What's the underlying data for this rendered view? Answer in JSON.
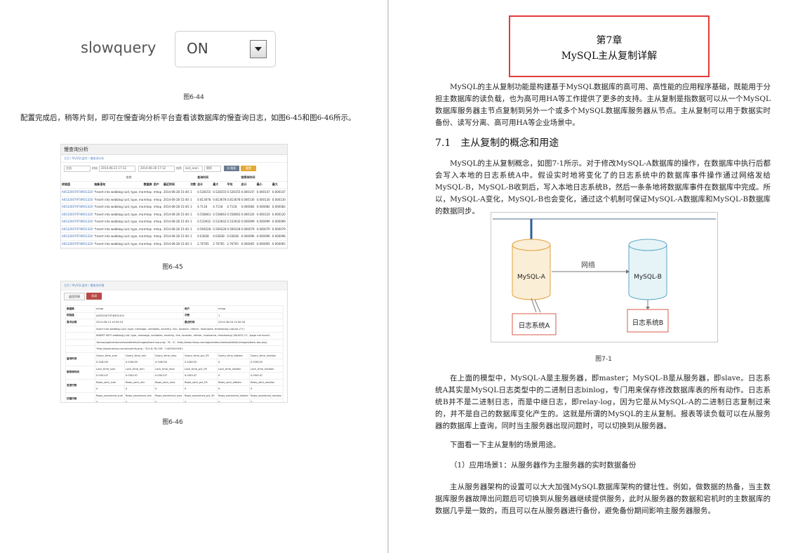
{
  "left": {
    "slowquery": {
      "label": "slowquery",
      "value": "ON"
    },
    "cap_44": "图6-44",
    "para_1": "配置完成后，稍等片刻，即可在慢查询分析平台查看该数据库的慢查询日志，如图6-45和图6-46所示。",
    "shot45": {
      "title": "慢查询分析",
      "breadcrumb": "主页 / MySQL监控 / 慢查询分析",
      "filter": {
        "host": "主机",
        "time_label": "时间",
        "time_from": "2014-06-21 17:12",
        "time_to": "2014-06-30 17:12",
        "sort_label": "排序",
        "sort_value": "last_seen",
        "order": "倒序",
        "search": "Q 搜索",
        "reset": "重置"
      },
      "group_1": "实时",
      "group_2": "查询时间",
      "group_3": "锁等待时间",
      "headers": [
        "校验值",
        "抽象语句",
        "数据库",
        "用户",
        "最近时间",
        "次数",
        "总计",
        "最大",
        "平均",
        "总计",
        "最小",
        "最大"
      ],
      "rows": [
        [
          "A05320079T4M31320",
          "*Insert into webblog (uid, type, mac",
          "mhop",
          "mhop",
          "2014-06-28 15:40:44",
          "1",
          "0.528155",
          "0.528155",
          "0.528155",
          "0.000147",
          "0.000147",
          "0.000147"
        ],
        [
          "A05320079T4M31320",
          "*Insert into webblog (uid, type, mac",
          "mhop",
          "mhop",
          "2014-06-28 15:40:44",
          "1",
          "0.813678",
          "0.813678",
          "0.813678",
          "0.000130",
          "0.000130",
          "0.000130"
        ],
        [
          "A05320079T4M31320",
          "*Insert into webblog (uid, type, mac",
          "mhop",
          "mhop",
          "2014-06-28 15:40:44",
          "1",
          "4.7118",
          "4.7118",
          "4.7118",
          "0.000082",
          "0.000082",
          "0.000082"
        ],
        [
          "A05320079T4M31320",
          "*Insert into webblog (uid, type, mac",
          "mhop",
          "mhop",
          "2014-06-28 15:40:44",
          "1",
          "0.558063",
          "0.558063",
          "0.558063",
          "0.000120",
          "0.000120",
          "0.000120"
        ],
        [
          "A05320079T4M31320",
          "*Insert into webblog (uid, type, mac",
          "mhop",
          "mhop",
          "2014-06-28 15:40:44",
          "1",
          "0.533932",
          "0.533932",
          "0.533932",
          "0.000099",
          "0.000099",
          "0.000099"
        ],
        [
          "A05320079T4M31320",
          "*Insert into webblog (uid, type, mac",
          "mhop",
          "mhop",
          "2014-06-28 15:40:44",
          "1",
          "0.569228",
          "0.569228",
          "0.569228",
          "0.000079",
          "0.000079",
          "0.000079"
        ],
        [
          "A05320079T4M31320",
          "*Insert into webblog (uid, type, mac",
          "mhop",
          "mhop",
          "2014-06-28 15:40:44",
          "1",
          "0.63838",
          "0.63838",
          "0.63838",
          "0.000096",
          "0.000096",
          "0.000096"
        ],
        [
          "A05320079T4M31320",
          "*Insert into webblog (uid, type, mac",
          "mhop",
          "mhop",
          "2014-06-28 15:40:44",
          "1",
          "2.76765",
          "2.76765",
          "2.76765",
          "0.000065",
          "0.000065",
          "0.000065"
        ]
      ]
    },
    "cap_45": "图6-45",
    "shot46": {
      "breadcrumb": "主页 / MySQL监控 / 慢查询详情",
      "btn_back": "返回列表",
      "btn_close": "关闭",
      "rows": [
        [
          "数据库",
          "mhop",
          "用户",
          "mhop"
        ],
        [
          "校验值",
          "A05320079T4M31320",
          "次数",
          "1"
        ],
        [
          "首次出现",
          "2014-06-13 14:59:24",
          "最近时间",
          "2014-06-28 15:40:44"
        ]
      ],
      "abstract": "insert into webblog (uid, type, message, variables, severity, link, location, referer, hostname, timestamp) values (?+)",
      "sample_1": "INSERT INTO webblog (uid, type, message, variables, severity, link, location, referer, hostname, timestamp) VALUES ('0', 'page not found',",
      "sample_2": "'demo/application/views/statistic/images/back-top.png', 'N', '4', 'http://www.mhop.com/application/views/statistic/images/back-top.png',",
      "sample_3": "'http://www.mhop.com/moreinfo.php', '221.6.76.150', '1403941916')",
      "metrics": [
        {
          "key": "查询时间",
          "heads": [
            "Query_time_sum",
            "Query_time_min",
            "Query_time_max",
            "Query_time_pct_95",
            "Query_time_stddev",
            "Query_time_median"
          ],
          "vals": [
            "0.528155",
            "0.528155",
            "0.528155",
            "0.528155",
            "0",
            "0.528155"
          ]
        },
        {
          "key": "锁等待时间",
          "heads": [
            "Lock_time_sum",
            "Lock_time_min",
            "Lock_time_max",
            "Lock_time_pct_95",
            "Lock_time_stddev",
            "Lock_time_median"
          ],
          "vals": [
            "0.000147",
            "0.000147",
            "0.000147",
            "0.000147",
            "0",
            "0.000147"
          ]
        },
        {
          "key": "发送行数",
          "heads": [
            "Rows_sent_sum",
            "Rows_sent_min",
            "Rows_sent_max",
            "Rows_sent_pct_95",
            "Rows_sent_stddev",
            "Rows_sent_median"
          ],
          "vals": [
            "0",
            "0",
            "0",
            "0",
            "0",
            "0"
          ]
        },
        {
          "key": "扫描行数",
          "heads": [
            "Rows_examined_sum",
            "Rows_examined_min",
            "Rows_examined_max",
            "Rows_examined_pct_95",
            "Rows_examined_stddev",
            "Rows_examined_median"
          ],
          "vals": [
            "0",
            "0",
            "0",
            "0",
            "0",
            "0"
          ]
        }
      ]
    },
    "cap_46": "图6-46"
  },
  "right": {
    "chapter_no": "第7章",
    "chapter_title": "MySQL主从复制详解",
    "intro": "MySQL的主从复制功能是构建基于MySQL数据库的高可用、高性能的应用程序基础，既能用于分担主数据库的读负载，也为高可用HA等工作提供了更多的支持。主从复制是指数据可以从一个MySQL数据库服务器主节点复制到另外一个或多个MySQL数据库服务器从节点。主从复制可以用于数据实时备份、读写分离、高可用HA等企业场景中。",
    "section": "7.1　主从复制的概念和用途",
    "para_2": "MySQL的主从复制概念，如图7-1所示。对于修改MySQL-A数据库的操作，在数据库中执行后都会写入本地的日志系统A中。假设实时地将变化了的日志系统中的数据库事件操作通过网络发给MySQL-B，MySQL-B收到后，写入本地日志系统B，然后一条条地将数据库事件在数据库中完成。所以，MySQL-A变化，MySQL-B也会变化，通过这个机制可保证MySQL-A数据库和MySQL-B数据库的数据同步。",
    "diagram": {
      "db_a": "MySQL-A",
      "db_b": "MySQL-B",
      "network": "网络",
      "log_a": "日志系统A",
      "log_b": "日志系统B"
    },
    "cap_71": "图7-1",
    "para_3": "在上面的模型中，MySQL-A是主服务器，即master；MySQL-B是从服务器，即slave。日志系统A其实是MySQL日志类型中的二进制日志binlog，专门用来保存修改数据库表的所有动作。日志系统B并不是二进制日志，而是中继日志，即relay-log，因为它是从MySQL-A的二进制日志复制过来的，并不是自己的数据库变化产生的。这就是所谓的MySQL的主从复制。报表等读负载可以在从服务器的数据库上查询，同时当主服务器出现问题时，可以切换到从服务器。",
    "para_4": "下面看一下主从复制的场景用途。",
    "para_5": "（1）应用场景1：从服务器作为主服务器的实时数据备份",
    "para_6": "主从服务器架构的设置可以大大加强MySQL数据库架构的健壮性。例如，做数据的热备，当主数据库服务器故障出问题后可切换到从服务器继续提供服务，此时从服务器的数据和宕机时的主数据库的数据几乎是一致的，而且可以在从服务器进行备份，避免备份期间影响主服务器服务。"
  }
}
